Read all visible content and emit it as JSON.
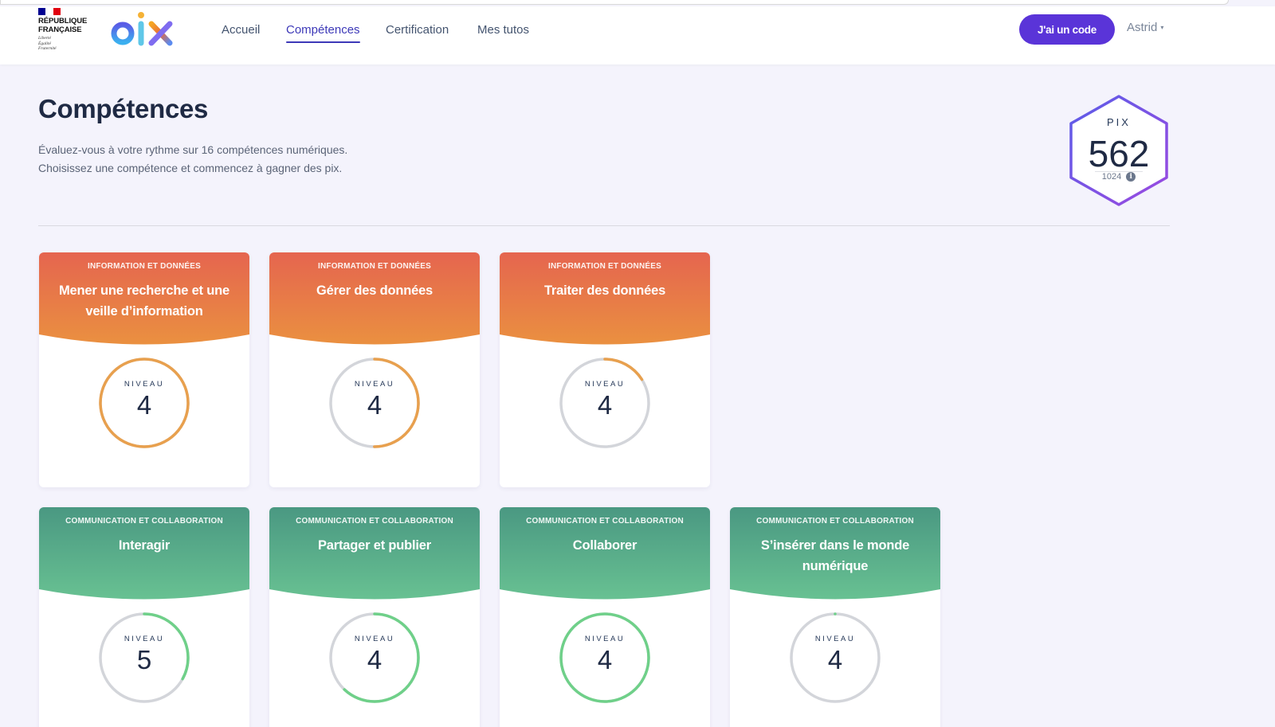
{
  "header": {
    "republique": {
      "name_line1": "RÉPUBLIQUE",
      "name_line2": "FRANÇAISE",
      "motto": [
        "Liberté",
        "Égalité",
        "Fraternité"
      ]
    },
    "logo_text": "pix",
    "nav": [
      {
        "label": "Accueil",
        "active": false
      },
      {
        "label": "Compétences",
        "active": true
      },
      {
        "label": "Certification",
        "active": false
      },
      {
        "label": "Mes tutos",
        "active": false
      }
    ],
    "code_button": "J'ai un code",
    "user_name": "Astrid",
    "caret": "▾"
  },
  "main": {
    "title": "Compétences",
    "subtitle_line1": "Évaluez-vous à votre rythme sur 16 compétences numériques.",
    "subtitle_line2": "Choisissez une compétence et commencez à gagner des pix.",
    "pix_score": {
      "label": "PIX",
      "score": "562",
      "max": "1024",
      "info_icon": "i"
    }
  },
  "level_label": "NIVEAU",
  "cards": [
    {
      "area": "INFORMATION ET DONNÉES",
      "name": "Mener une recherche et une veille d’information",
      "level": "4",
      "progress": 1.0,
      "theme": "orange"
    },
    {
      "area": "INFORMATION ET DONNÉES",
      "name": "Gérer des données",
      "level": "4",
      "progress": 0.5,
      "theme": "orange"
    },
    {
      "area": "INFORMATION ET DONNÉES",
      "name": "Traiter des données",
      "level": "4",
      "progress": 0.16,
      "theme": "orange"
    },
    {
      "area": "COMMUNICATION ET COLLABORATION",
      "name": "Interagir",
      "level": "5",
      "progress": 0.33,
      "theme": "green"
    },
    {
      "area": "COMMUNICATION ET COLLABORATION",
      "name": "Partager et publier",
      "level": "4",
      "progress": 0.62,
      "theme": "green"
    },
    {
      "area": "COMMUNICATION ET COLLABORATION",
      "name": "Collaborer",
      "level": "4",
      "progress": 1.0,
      "theme": "green"
    },
    {
      "area": "COMMUNICATION ET COLLABORATION",
      "name": "S’insérer dans le monde numérique",
      "level": "4",
      "progress": 0.0,
      "theme": "green"
    }
  ],
  "colors": {
    "accent": "#3d39b8",
    "button": "#5a34d8",
    "orange_top": "#e5654f",
    "orange_bottom": "#ea9040",
    "orange_ring": "#e8a04e",
    "green_top": "#4a9882",
    "green_bottom": "#68c192",
    "green_ring": "#6fd089",
    "ring_track": "#d3d5da",
    "flag_blue": "#000091",
    "flag_red": "#e1000f"
  }
}
